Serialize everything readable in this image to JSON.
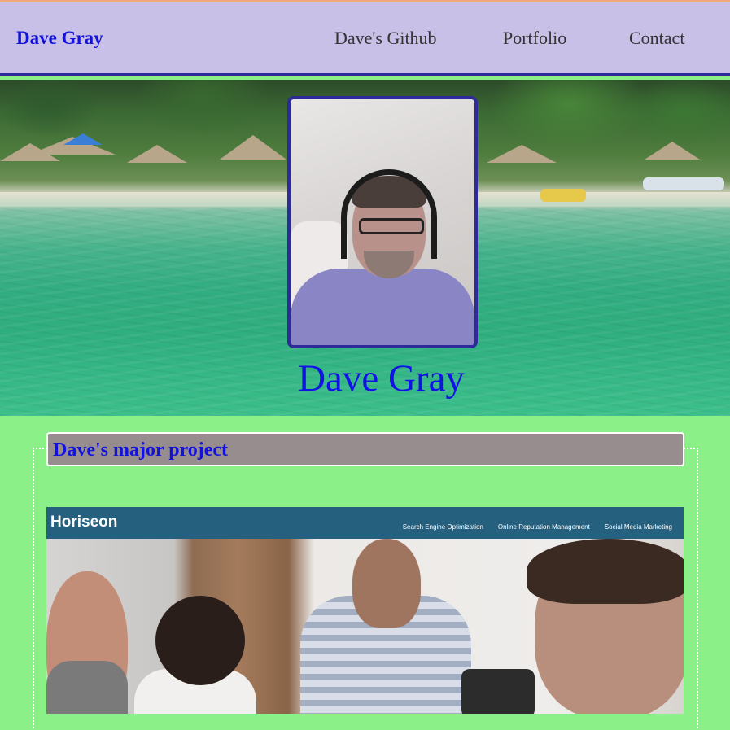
{
  "header": {
    "brand": "Dave Gray",
    "nav": [
      {
        "label": "Dave's Github"
      },
      {
        "label": "Portfolio"
      },
      {
        "label": "Contact"
      }
    ]
  },
  "hero": {
    "name": "Dave Gray"
  },
  "project": {
    "heading": "Dave's major project",
    "screenshot": {
      "logo": "Horiseon",
      "links": [
        "Search Engine Optimization",
        "Online Reputation Management",
        "Social Media Marketing"
      ]
    }
  },
  "colors": {
    "header_bg": "#c8c0e6",
    "accent_border": "#2e2a9a",
    "link_blue": "#1212d8",
    "page_bg": "#8cf088",
    "heading_bg": "#978d8f",
    "horiseon_bar": "#25607f"
  }
}
